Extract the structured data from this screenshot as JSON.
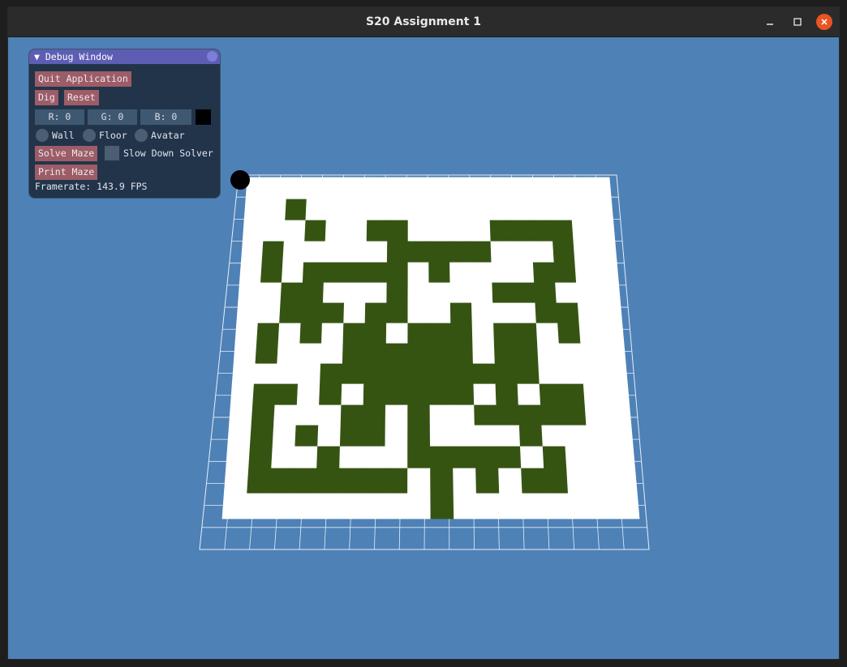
{
  "window": {
    "title": "S20 Assignment 1"
  },
  "colors": {
    "background": "#4e81b6",
    "wall": "#355412",
    "floor": "#ffffff",
    "grid": "#e6eef8",
    "avatar": "#000000"
  },
  "debug_window": {
    "title": "Debug Window",
    "collapse_glyph": "▼",
    "quit_label": "Quit Application",
    "dig_label": "Dig",
    "reset_label": "Reset",
    "color": {
      "r": "R:  0",
      "g": "G:  0",
      "b": "B:  0"
    },
    "radio": {
      "wall": "Wall",
      "floor": "Floor",
      "avatar": "Avatar"
    },
    "solve_label": "Solve Maze",
    "slow_label": "Slow Down Solver",
    "print_label": "Print Maze",
    "framerate": "Framerate: 143.9 FPS"
  },
  "maze": {
    "rows": 16,
    "cols": 18,
    "grid": [
      "..................",
      "..X...............",
      "...X..XX....XXXX..",
      ".X.....XXXXX...X..",
      ".X.XXXXX.X....XX..",
      "..XX...X....XXX...",
      "..XXX.XX..X...XX..",
      ".X.X.XX.XXX.XX.X..",
      ".X...XXXXXX.XX....",
      "....XXXXXXXXXX....",
      ".XX.X.XXXXX.X.XX..",
      ".X...XX.X..XXXXX..",
      ".X.X.XX.X....X....",
      ".X..X...XXXXX.X...",
      ".XXXXXXX.X.X.XX...",
      ".........X........"
    ]
  }
}
